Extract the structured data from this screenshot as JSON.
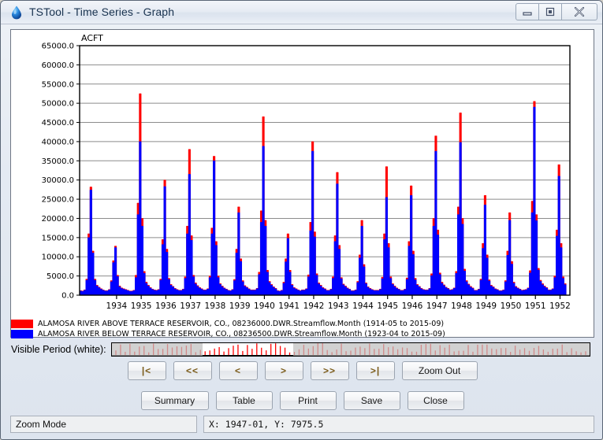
{
  "window": {
    "title": "TSTool - Time Series - Graph",
    "icon": "water-drop-icon",
    "minimize_label": "–",
    "maximize_label": "□",
    "close_label": "✕"
  },
  "legend": [
    {
      "color": "#ff0000",
      "label": "ALAMOSA RIVER ABOVE TERRACE RESERVOIR, CO., 08236000.DWR.Streamflow.Month (1914-05 to 2015-09)"
    },
    {
      "color": "#0000ff",
      "label": "ALAMOSA RIVER BELOW TERRACE RESERVOIR, CO., 08236500.DWR.Streamflow.Month (1923-04 to 2015-09)"
    }
  ],
  "visible_period": {
    "label": "Visible Period (white):",
    "window_start_pct": 19.0,
    "window_end_pct": 38.0,
    "mask_color": "#bfbfbf",
    "trace_color": "#ff0000"
  },
  "nav_buttons": [
    {
      "label": "|<",
      "name": "nav-first-button"
    },
    {
      "label": "<<",
      "name": "nav-page-back-button"
    },
    {
      "label": "<",
      "name": "nav-step-back-button"
    },
    {
      "label": ">",
      "name": "nav-step-forward-button"
    },
    {
      "label": ">>",
      "name": "nav-page-forward-button"
    },
    {
      "label": ">|",
      "name": "nav-last-button"
    },
    {
      "label": "Zoom Out",
      "name": "zoom-out-button"
    }
  ],
  "action_buttons": [
    {
      "label": "Summary",
      "name": "summary-button"
    },
    {
      "label": "Table",
      "name": "table-button"
    },
    {
      "label": "Print",
      "name": "print-button"
    },
    {
      "label": "Save",
      "name": "save-button"
    },
    {
      "label": "Close",
      "name": "close-button"
    }
  ],
  "status": {
    "mode": "Zoom Mode",
    "coordinates": "X:  1947-01,  Y:  7975.5"
  },
  "chart_data": {
    "type": "area",
    "title": "",
    "ylabel": "ACFT",
    "xlabel": "",
    "ylim": [
      0,
      65000
    ],
    "ytick_step": 5000,
    "ytick_labels": [
      "0.0",
      "5000.0",
      "10000.0",
      "15000.0",
      "20000.0",
      "25000.0",
      "30000.0",
      "35000.0",
      "40000.0",
      "45000.0",
      "50000.0",
      "55000.0",
      "60000.0",
      "65000.0"
    ],
    "xlim_years": [
      1933.0,
      1952.9
    ],
    "xtick_labels": [
      "1934",
      "1935",
      "1936",
      "1937",
      "1938",
      "1939",
      "1940",
      "1941",
      "1942",
      "1943",
      "1944",
      "1945",
      "1946",
      "1947",
      "1948",
      "1949",
      "1950",
      "1951",
      "1952"
    ],
    "grid": "horizontal",
    "legend_position": "below",
    "series": [
      {
        "name": "ALAMOSA RIVER ABOVE TERRACE RESERVOIR, CO., 08236000.DWR.Streamflow.Month",
        "color": "#ff0000",
        "start": "1933-01",
        "values": [
          1200,
          1100,
          1400,
          4200,
          16000,
          28200,
          11500,
          4200,
          2600,
          2100,
          1700,
          1400,
          1200,
          1200,
          1500,
          3800,
          9000,
          12800,
          5200,
          2400,
          1900,
          1700,
          1500,
          1300,
          1100,
          1100,
          1300,
          5200,
          24000,
          52500,
          20000,
          6200,
          3400,
          2600,
          2000,
          1600,
          1400,
          1300,
          1500,
          4200,
          14500,
          30000,
          12000,
          4400,
          2800,
          2300,
          1800,
          1500,
          1300,
          1300,
          1600,
          4800,
          18000,
          38000,
          15500,
          5200,
          3200,
          2500,
          2000,
          1700,
          1400,
          1400,
          1700,
          5000,
          17500,
          36200,
          14000,
          5000,
          3000,
          2400,
          1900,
          1600,
          1300,
          1200,
          1500,
          4100,
          12000,
          23000,
          9500,
          3800,
          2500,
          2100,
          1700,
          1400,
          1400,
          1400,
          1800,
          6000,
          22000,
          46500,
          19500,
          6500,
          3600,
          2800,
          2200,
          1800,
          1200,
          1100,
          1300,
          3400,
          9500,
          16000,
          6500,
          2800,
          2000,
          1700,
          1400,
          1200,
          1400,
          1400,
          1700,
          5300,
          19000,
          40000,
          16500,
          5600,
          3200,
          2600,
          2000,
          1700,
          1300,
          1300,
          1600,
          4800,
          15500,
          32000,
          13000,
          4600,
          2900,
          2400,
          1900,
          1600,
          1200,
          1200,
          1400,
          3600,
          10500,
          19500,
          8000,
          3200,
          2200,
          1800,
          1500,
          1300,
          1300,
          1300,
          1600,
          4700,
          16000,
          33500,
          13500,
          4800,
          3000,
          2400,
          1900,
          1600,
          1300,
          1300,
          1600,
          4500,
          14000,
          28500,
          11500,
          4400,
          2800,
          2300,
          1800,
          1500,
          1400,
          1400,
          1800,
          5600,
          20000,
          41500,
          17000,
          5800,
          3400,
          2700,
          2100,
          1800,
          1400,
          1500,
          1900,
          6200,
          23000,
          47500,
          20000,
          6800,
          3800,
          2900,
          2300,
          1900,
          1300,
          1300,
          1600,
          4200,
          13500,
          26000,
          10500,
          4000,
          2600,
          2200,
          1700,
          1500,
          1200,
          1200,
          1400,
          3800,
          11500,
          21500,
          8800,
          3400,
          2300,
          1900,
          1600,
          1300,
          1400,
          1500,
          1900,
          6400,
          24500,
          50500,
          21000,
          7000,
          3900,
          3000,
          2400,
          2000,
          1400,
          1400,
          1700,
          5000,
          17000,
          34000,
          13500,
          4800,
          3000
        ]
      },
      {
        "name": "ALAMOSA RIVER BELOW TERRACE RESERVOIR, CO., 08236500.DWR.Streamflow.Month",
        "color": "#0000ff",
        "start": "1933-01",
        "values": [
          1100,
          1000,
          1300,
          3900,
          15000,
          27400,
          11000,
          3900,
          2400,
          1950,
          1550,
          1300,
          1100,
          1100,
          1400,
          3500,
          8500,
          12400,
          4900,
          2200,
          1750,
          1550,
          1400,
          1200,
          1000,
          1000,
          1200,
          4600,
          21000,
          40000,
          18000,
          5700,
          3100,
          2400,
          1850,
          1500,
          1300,
          1200,
          1400,
          3900,
          13200,
          28300,
          11200,
          4100,
          2600,
          2150,
          1650,
          1400,
          1200,
          1200,
          1500,
          4400,
          16000,
          31500,
          14300,
          4800,
          2950,
          2300,
          1850,
          1550,
          1300,
          1300,
          1600,
          4600,
          16000,
          35000,
          13000,
          4600,
          2800,
          2200,
          1750,
          1500,
          1200,
          1100,
          1400,
          3800,
          11000,
          21500,
          8800,
          3500,
          2300,
          1950,
          1550,
          1300,
          1300,
          1300,
          1700,
          5400,
          19000,
          38800,
          18000,
          6000,
          3300,
          2600,
          2050,
          1650,
          1100,
          1000,
          1200,
          3100,
          8700,
          14800,
          6000,
          2600,
          1850,
          1550,
          1300,
          1100,
          1300,
          1300,
          1600,
          4800,
          16800,
          37500,
          15200,
          5200,
          2950,
          2400,
          1850,
          1550,
          1200,
          1200,
          1500,
          4400,
          14000,
          29000,
          12000,
          4300,
          2700,
          2200,
          1750,
          1500,
          1100,
          1100,
          1300,
          3300,
          9700,
          18000,
          7400,
          3000,
          2050,
          1650,
          1400,
          1200,
          1200,
          1200,
          1500,
          4300,
          14500,
          25500,
          12400,
          4400,
          2800,
          2200,
          1750,
          1500,
          1200,
          1200,
          1500,
          4100,
          12800,
          26000,
          10600,
          4000,
          2600,
          2150,
          1650,
          1400,
          1300,
          1300,
          1700,
          5100,
          18000,
          37500,
          15700,
          5400,
          3100,
          2500,
          1950,
          1650,
          1300,
          1400,
          1800,
          5700,
          21000,
          39800,
          18500,
          6300,
          3500,
          2700,
          2100,
          1750,
          1200,
          1200,
          1500,
          3900,
          12200,
          23500,
          9700,
          3700,
          2400,
          2050,
          1550,
          1400,
          1100,
          1100,
          1300,
          3500,
          10400,
          19500,
          8100,
          3100,
          2100,
          1750,
          1500,
          1200,
          1300,
          1400,
          1800,
          5800,
          21500,
          49000,
          19400,
          6500,
          3600,
          2750,
          2200,
          1850,
          1300,
          1300,
          1600,
          4600,
          15400,
          31000,
          12400,
          4400,
          2750
        ]
      }
    ]
  }
}
